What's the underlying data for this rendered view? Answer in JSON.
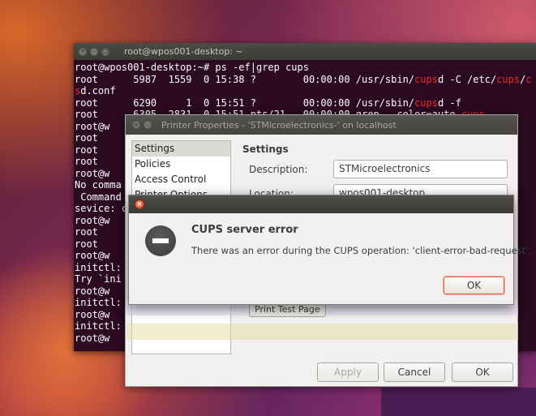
{
  "terminal": {
    "title": "root@wpos001-desktop: ~",
    "lines": [
      [
        {
          "t": "root@wpos001-desktop:~# ps -ef|grep cups"
        }
      ],
      [
        {
          "t": "root      5987  1559  0 15:38 ?        00:00:00 /usr/sbin/"
        },
        {
          "t": "cups",
          "red": true
        },
        {
          "t": "d -C /etc/"
        },
        {
          "t": "cups",
          "red": true
        },
        {
          "t": "/"
        },
        {
          "t": "c",
          "red": true
        }
      ],
      [
        {
          "t": "s",
          "red": true
        },
        {
          "t": "d.conf"
        }
      ],
      [
        {
          "t": "root      6290     1  0 15:51 ?        00:00:00 /usr/sbin/"
        },
        {
          "t": "cups",
          "red": true
        },
        {
          "t": "d -f"
        }
      ],
      [
        {
          "t": "root      6305  2831  0 15:51 pts/21   00:00:00 grep --color=auto "
        },
        {
          "t": "cups",
          "red": true
        }
      ],
      [
        {
          "t": "root@w"
        }
      ],
      [
        {
          "t": "root"
        }
      ],
      [
        {
          "t": "root"
        }
      ],
      [
        {
          "t": "root"
        }
      ],
      [
        {
          "t": "root@w"
        }
      ],
      [
        {
          "t": "No comma"
        }
      ],
      [
        {
          "t": " Command"
        }
      ],
      [
        {
          "t": "sevice: c"
        }
      ],
      [
        {
          "t": "root@w"
        }
      ],
      [
        {
          "t": "root"
        }
      ],
      [
        {
          "t": "root"
        }
      ],
      [
        {
          "t": "root@w"
        }
      ],
      [
        {
          "t": "initctl:"
        }
      ],
      [
        {
          "t": "Try `ini"
        }
      ],
      [
        {
          "t": "root@w"
        }
      ],
      [
        {
          "t": "initctl:"
        }
      ],
      [
        {
          "t": "root@w"
        }
      ],
      [
        {
          "t": "initctl:"
        }
      ],
      [
        {
          "t": "root@w"
        }
      ]
    ]
  },
  "printer_properties": {
    "title": "Printer Properties - 'STMicroelectronics-' on localhost",
    "sidebar": [
      {
        "label": "Settings",
        "selected": true
      },
      {
        "label": "Policies",
        "selected": false
      },
      {
        "label": "Access Control",
        "selected": false
      },
      {
        "label": "Printer Options",
        "selected": false
      }
    ],
    "section_heading": "Settings",
    "description_label": "Description:",
    "description_value": "STMicroelectronics",
    "location_label": "Location:",
    "location_value": "wpos001-desktop",
    "print_test_page_label": "Print Test Page",
    "buttons": {
      "apply": "Apply",
      "cancel": "Cancel",
      "ok": "OK"
    }
  },
  "error_dialog": {
    "heading": "CUPS server error",
    "message": "There was an error during the CUPS operation: 'client-error-bad-request'.",
    "ok_label": "OK"
  }
}
